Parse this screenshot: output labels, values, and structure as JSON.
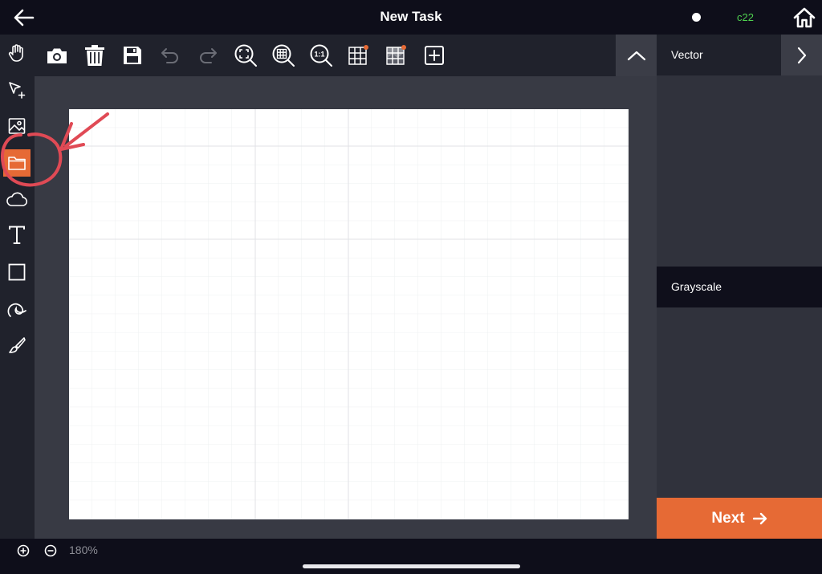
{
  "header": {
    "title": "New Task",
    "status_code": "c22",
    "status_code_color": "#4fd14f",
    "back_icon": "arrow-left-icon",
    "home_icon": "home-icon"
  },
  "tool_rail": {
    "items": [
      {
        "name": "pan-hand",
        "icon": "hand-icon"
      },
      {
        "name": "select-add",
        "icon": "pointer-plus-icon"
      },
      {
        "name": "image",
        "icon": "image-icon"
      },
      {
        "name": "folder",
        "icon": "folder-icon",
        "active": true
      },
      {
        "name": "cloud",
        "icon": "cloud-icon"
      },
      {
        "name": "text",
        "icon": "text-icon"
      },
      {
        "name": "rectangle",
        "icon": "rectangle-icon"
      },
      {
        "name": "spiral-draw",
        "icon": "spiral-icon"
      },
      {
        "name": "brush",
        "icon": "brush-icon"
      }
    ],
    "active_color": "#e66a35"
  },
  "toolbar": {
    "items": [
      "camera-icon",
      "trash-icon",
      "save-icon",
      "undo-icon",
      "redo-icon",
      "zoom-fit-icon",
      "zoom-grid-icon",
      "zoom-actual-icon",
      "grid-icon",
      "grid-photo-icon",
      "add-box-icon"
    ],
    "zoom_actual_text": "1:1",
    "collapse_icon": "chevron-up-icon"
  },
  "right_panel": {
    "vector_label": "Vector",
    "grayscale_label": "Grayscale",
    "next_label": "Next",
    "next_color": "#e66a35"
  },
  "bottom": {
    "zoom_level": "180%"
  },
  "annotation": {
    "color": "#e04a55"
  }
}
